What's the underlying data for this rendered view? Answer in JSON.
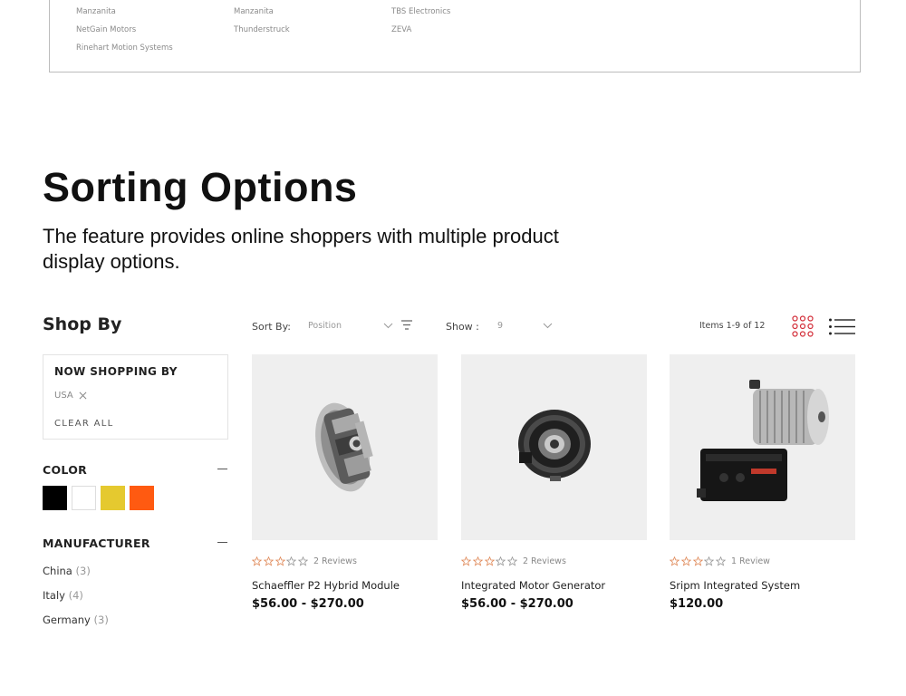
{
  "manufacturer_links": [
    [
      "Manzanita",
      "Manzanita",
      "TBS Electronics"
    ],
    [
      "NetGain Motors",
      "Thunderstruck",
      "ZEVA"
    ],
    [
      "Rinehart Motion Systems",
      "",
      ""
    ]
  ],
  "feature": {
    "title": "Sorting Options",
    "desc": "The feature provides online shoppers with multiple product display options."
  },
  "sidebar": {
    "title": "Shop By",
    "now_shopping": {
      "title": "NOW SHOPPING BY",
      "filter": "USA",
      "clear": "CLEAR ALL"
    },
    "color": {
      "title": "COLOR",
      "swatches": [
        "#000000",
        "#ffffff",
        "#e5c92f",
        "#ff5a11"
      ]
    },
    "manufacturer": {
      "title": "MANUFACTURER",
      "items": [
        {
          "name": "China",
          "count": "(3)"
        },
        {
          "name": "Italy",
          "count": "(4)"
        },
        {
          "name": "Germany",
          "count": "(3)"
        }
      ]
    }
  },
  "toolbar": {
    "sort_label": "Sort By:",
    "sort_value": "Position",
    "show_label": "Show :",
    "show_value": "9",
    "items": "Items 1-9 of 12",
    "grid_icon_color": "#d32f3a"
  },
  "products": [
    {
      "name": "Schaeffler P2 Hybrid Module",
      "reviews": "2 Reviews",
      "price": "$56.00 - $270.00",
      "image": "hybrid-module-image",
      "stars": 0
    },
    {
      "name": "Integrated Motor Generator",
      "reviews": "2 Reviews",
      "price": "$56.00 - $270.00",
      "image": "motor-generator-image",
      "stars": 0
    },
    {
      "name": "Sripm Integrated System",
      "reviews": "1 Review",
      "price": "$120.00",
      "image": "integrated-system-image",
      "stars": 0
    }
  ],
  "colors": {
    "star": "#e08a5a",
    "border": "#e3e3e3",
    "image_bg": "#efefef"
  }
}
